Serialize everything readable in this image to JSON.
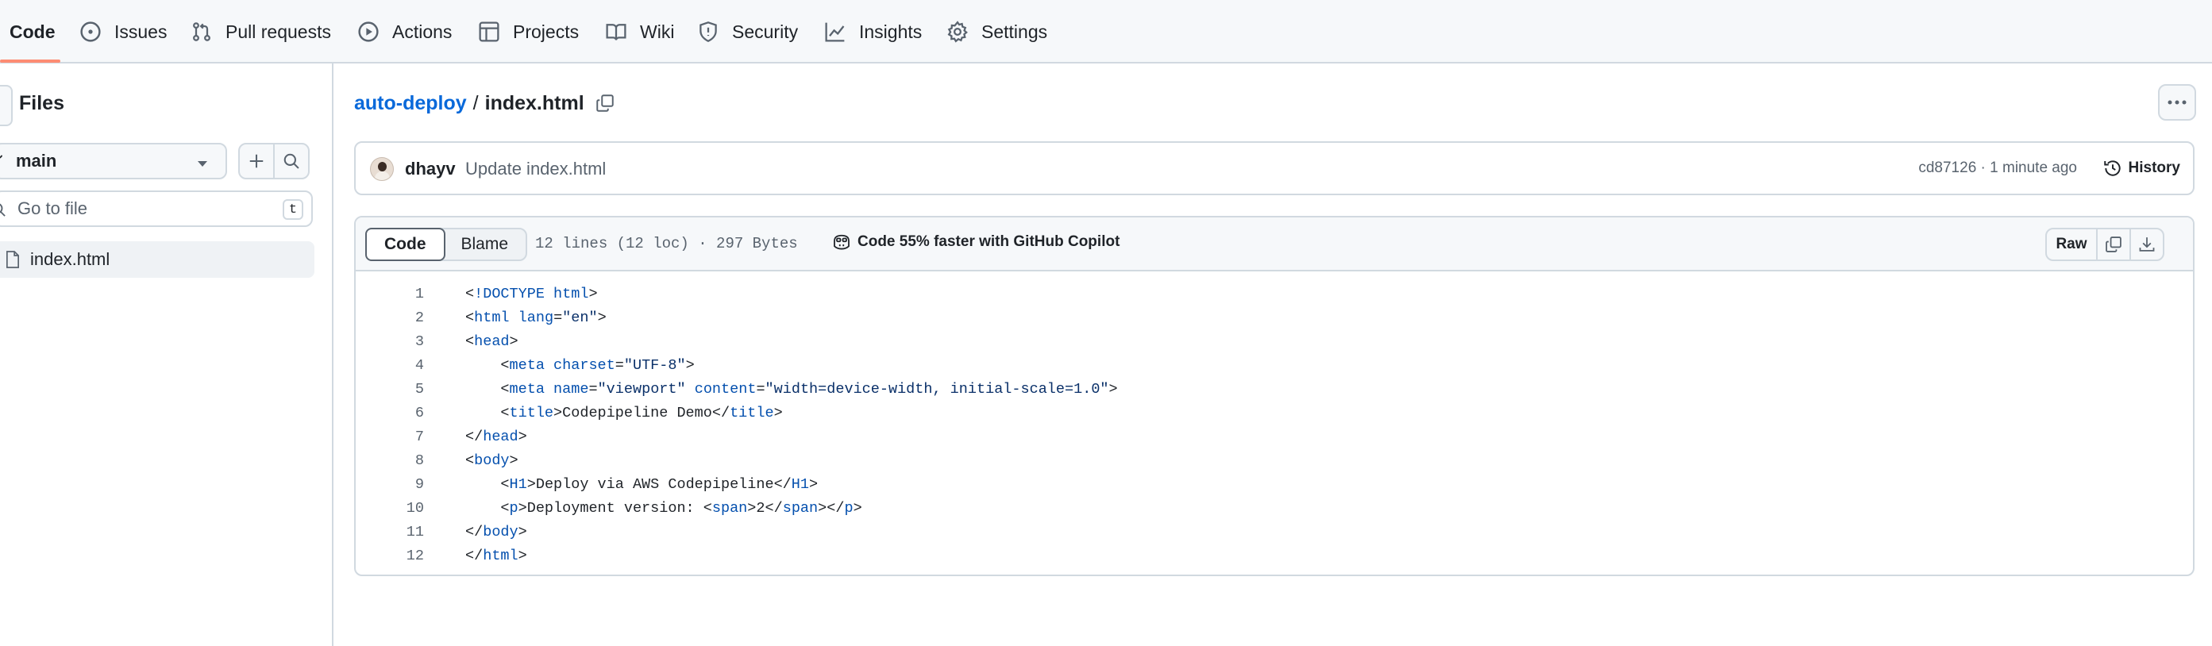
{
  "repo_nav": {
    "tabs": [
      {
        "label": "Code",
        "icon": "code-icon",
        "selected": true
      },
      {
        "label": "Issues",
        "icon": "issue-opened-icon"
      },
      {
        "label": "Pull requests",
        "icon": "git-pull-request-icon"
      },
      {
        "label": "Actions",
        "icon": "play-icon"
      },
      {
        "label": "Projects",
        "icon": "table-icon"
      },
      {
        "label": "Wiki",
        "icon": "book-icon"
      },
      {
        "label": "Security",
        "icon": "shield-icon"
      },
      {
        "label": "Insights",
        "icon": "graph-icon"
      },
      {
        "label": "Settings",
        "icon": "gear-icon"
      }
    ],
    "accent_color": "#fd8c73"
  },
  "sidebar": {
    "title": "Files",
    "branch": "main",
    "go_to_file_placeholder": "Go to file",
    "shortcut_key": "t",
    "files": [
      {
        "name": "index.html",
        "selected": true
      }
    ]
  },
  "breadcrumb": {
    "repo": "auto-deploy",
    "separator": "/",
    "file": "index.html"
  },
  "commit": {
    "author": "dhayv",
    "message": "Update index.html",
    "meta": "cd87126 · 1 minute ago",
    "history_label": "History"
  },
  "file_view": {
    "tab_code": "Code",
    "tab_blame": "Blame",
    "stats": "12 lines (12 loc) · 297 Bytes",
    "copilot_text": "Code 55% faster with GitHub Copilot",
    "raw_label": "Raw",
    "link_color": "#0969da"
  },
  "code": [
    {
      "n": "1",
      "t": "<!DOCTYPE html>"
    },
    {
      "n": "2",
      "t": "<html lang=\"en\">"
    },
    {
      "n": "3",
      "t": "<head>"
    },
    {
      "n": "4",
      "t": "    <meta charset=\"UTF-8\">"
    },
    {
      "n": "5",
      "t": "    <meta name=\"viewport\" content=\"width=device-width, initial-scale=1.0\">"
    },
    {
      "n": "6",
      "t": "    <title>Codepipeline Demo</title>"
    },
    {
      "n": "7",
      "t": "</head>"
    },
    {
      "n": "8",
      "t": "<body>"
    },
    {
      "n": "9",
      "t": "    <H1>Deploy via AWS Codepipeline</H1>"
    },
    {
      "n": "10",
      "t": "    <p>Deployment version: <span>2</span></p>"
    },
    {
      "n": "11",
      "t": "</body>"
    },
    {
      "n": "12",
      "t": "</html>"
    }
  ]
}
